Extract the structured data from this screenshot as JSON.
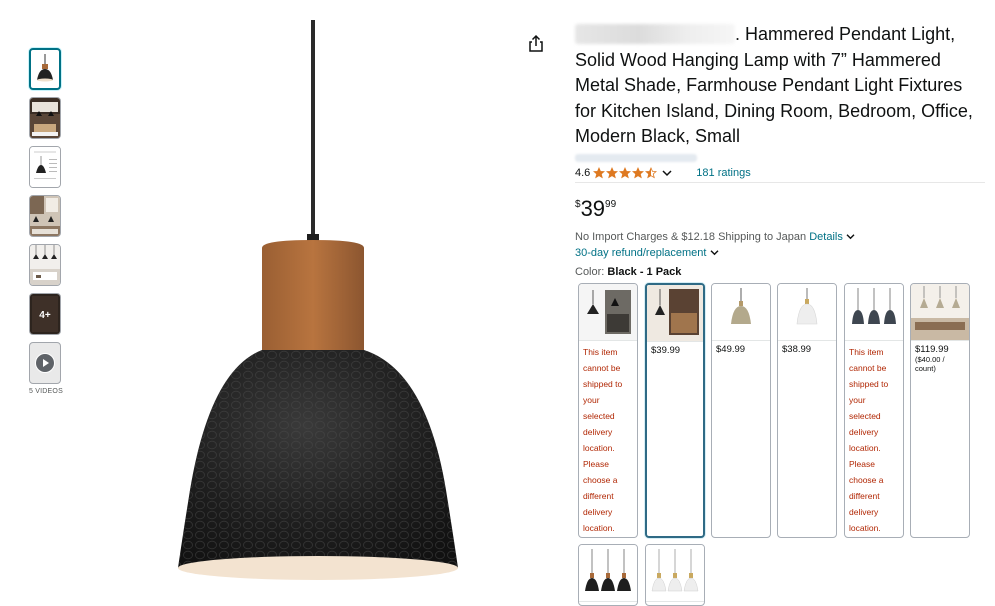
{
  "thumbnails": [
    {
      "label": "pendant-lamp-thumbnail",
      "active": true
    },
    {
      "label": "room-scene-thumbnail"
    },
    {
      "label": "dimensions-thumbnail"
    },
    {
      "label": "kitchen-scene-thumbnail"
    },
    {
      "label": "three-lamps-thumbnail"
    },
    {
      "label": "more-images-thumbnail",
      "overlay": "4+"
    },
    {
      "label": "video-thumbnail"
    }
  ],
  "videos_label": "5 VIDEOS",
  "title": {
    "text": ". Hammered Pendant Light, Solid Wood Hanging Lamp with 7” Hammered Metal Shade, Farmhouse Pendant Light Fixtures for Kitchen Island, Dining Room, Bedroom, Office, Modern Black, Small"
  },
  "rating": {
    "value": "4.6",
    "stars": 4.5,
    "count_label": "181 ratings"
  },
  "price": {
    "currency": "$",
    "whole": "39",
    "fraction": "99"
  },
  "shipping": {
    "text": "No Import Charges & $12.18 Shipping to Japan",
    "details_link": "Details"
  },
  "refund_text": "30-day refund/replacement",
  "color": {
    "label": "Color:",
    "selected": "Black - 1 Pack"
  },
  "swatches": [
    {
      "unavailable_lines": [
        "This item",
        "cannot be",
        "shipped to",
        "your",
        "selected",
        "delivery",
        "location.",
        "Please",
        "choose a",
        "different",
        "delivery",
        "location."
      ]
    },
    {
      "price": "$39.99",
      "selected": true
    },
    {
      "price": "$49.99"
    },
    {
      "price": "$38.99"
    },
    {
      "unavailable_lines": [
        "This item",
        "cannot be",
        "shipped to",
        "your",
        "selected",
        "delivery",
        "location.",
        "Please",
        "choose a",
        "different",
        "delivery",
        "location."
      ]
    },
    {
      "price": "$119.99",
      "unit": "($40.00 /",
      "unit2": "count)"
    }
  ],
  "colors": {
    "link": "#007185",
    "star": "#de7921",
    "unavailable": "#b12704",
    "selected_border": "#2f6a85"
  }
}
